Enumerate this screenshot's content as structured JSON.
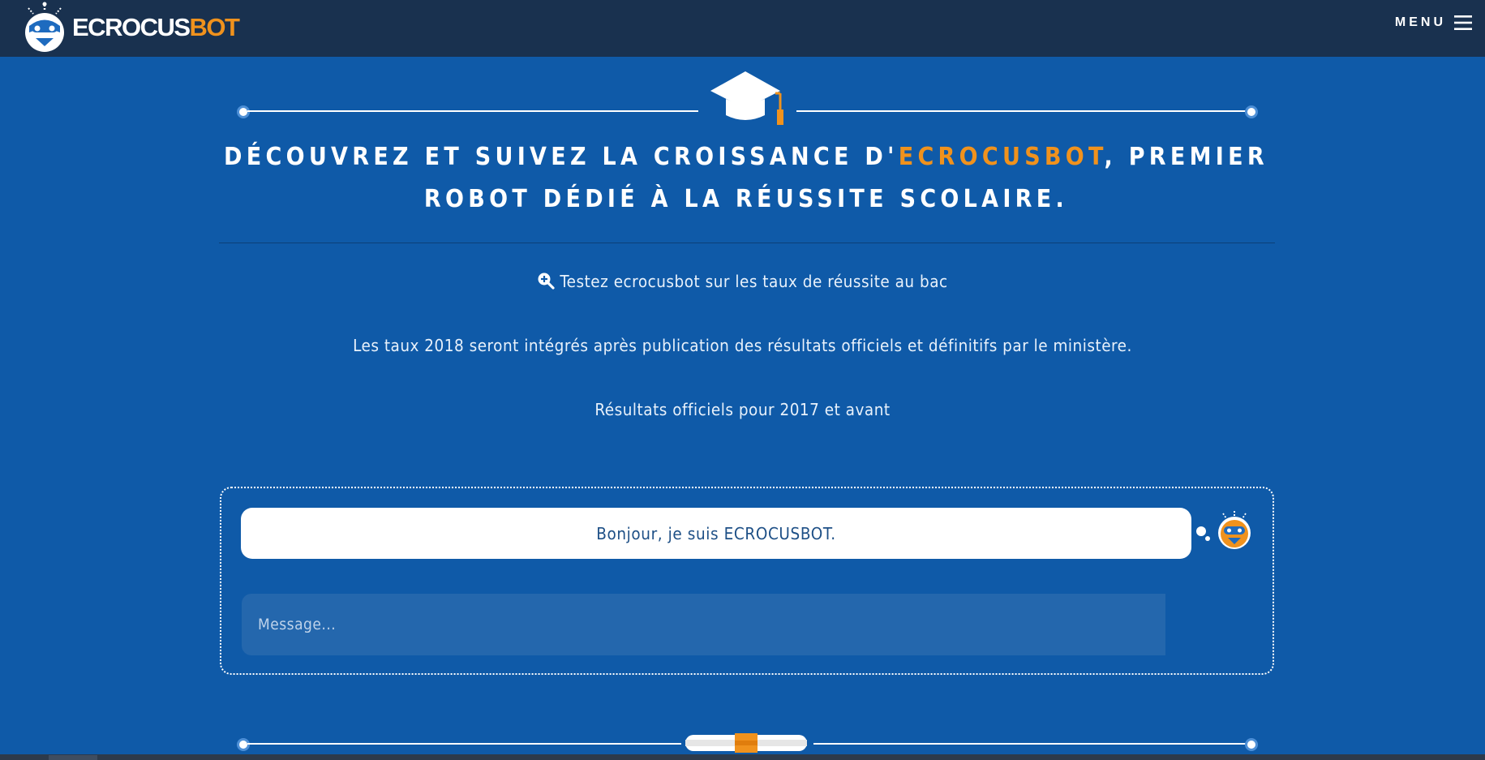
{
  "header": {
    "brand_part1": "ECROCUS",
    "brand_part2": "BOT",
    "menu_label": "MENU",
    "logo_icon": "robot-logo-icon",
    "menu_icon": "hamburger-icon"
  },
  "hero": {
    "decor_icon": "graduation-cap-icon",
    "headline_before": "DÉCOUVREZ ET SUIVEZ LA CROISSANCE D'",
    "headline_accent": "ECROCUSBOT",
    "headline_after": ", PREMIER ROBOT DÉDIÉ À LA RÉUSSITE SCOLAIRE."
  },
  "content": {
    "test_link_icon": "zoom-in-icon",
    "test_link": "Testez ecrocusbot sur les taux de réussite au bac",
    "notice": "Les taux 2018 seront intégrés après publication des résultats officiels et définitifs par le ministère.",
    "results_caption": "Résultats officiels pour 2017 et avant"
  },
  "chat": {
    "bot_message": "Bonjour, je suis ECROCUSBOT.",
    "bot_avatar_icon": "robot-avatar-icon",
    "input_value": "",
    "input_placeholder": "Message..."
  },
  "footer": {
    "decor_icon": "diploma-scroll-icon"
  },
  "colors": {
    "background": "#0f5aa8",
    "navbar": "#19314f",
    "accent": "#f0921d",
    "input_background": "#2467ad",
    "bubble_text": "#1d4f86"
  }
}
